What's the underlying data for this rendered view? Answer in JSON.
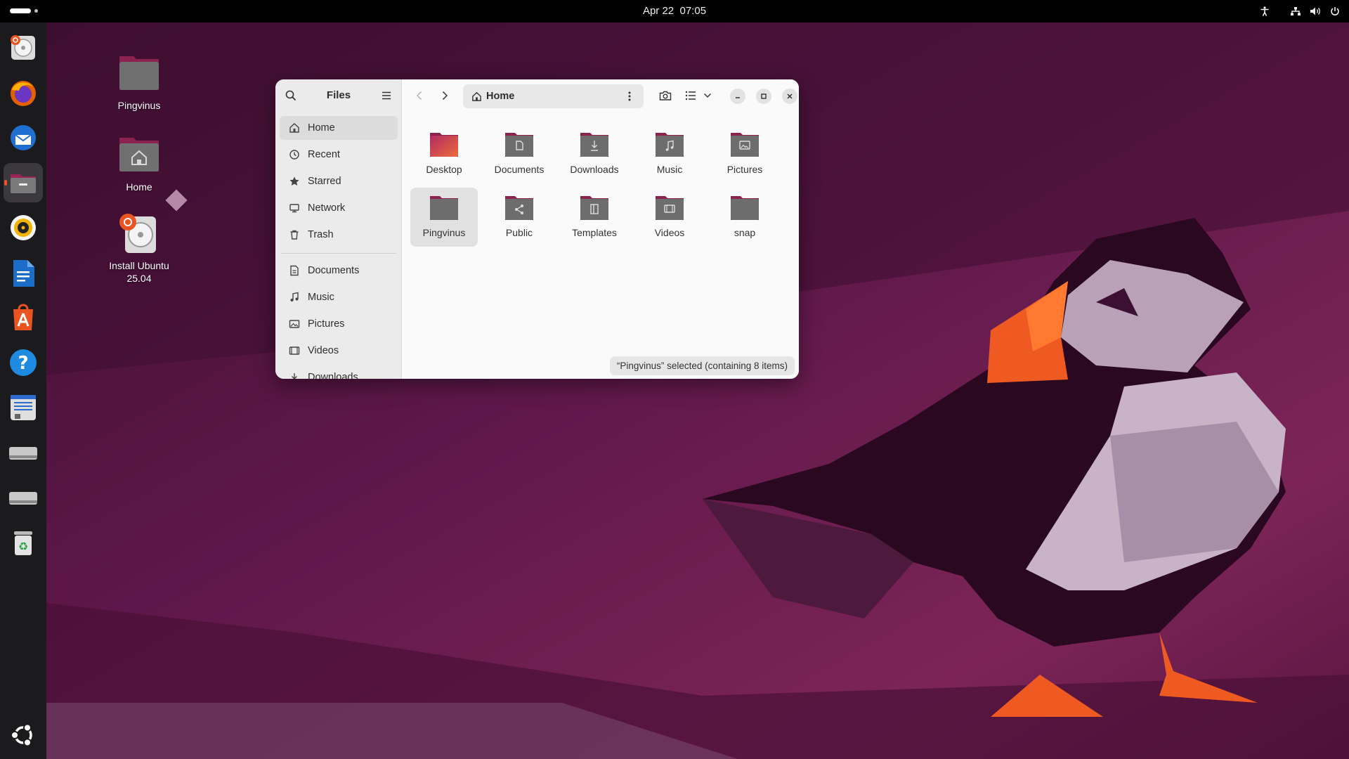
{
  "topbar": {
    "date": "Apr 22",
    "time": "07:05"
  },
  "dock": {
    "items": [
      {
        "name": "installer-dock-icon"
      },
      {
        "name": "firefox-dock-icon"
      },
      {
        "name": "thunderbird-dock-icon"
      },
      {
        "name": "files-dock-icon",
        "active": true
      },
      {
        "name": "rhythmbox-dock-icon"
      },
      {
        "name": "writer-dock-icon"
      },
      {
        "name": "app-center-dock-icon"
      },
      {
        "name": "help-dock-icon"
      },
      {
        "name": "text-editor-dock-icon"
      },
      {
        "name": "drive-dock-icon"
      },
      {
        "name": "drive-dock-icon"
      },
      {
        "name": "trash-dock-icon"
      }
    ],
    "show_apps_icon": "ubuntu-logo-icon"
  },
  "desktop": {
    "icons": [
      {
        "label": "Pingvinus"
      },
      {
        "label": "Home"
      },
      {
        "label_line1": "Install Ubuntu",
        "label_line2": "25.04"
      }
    ]
  },
  "files_window": {
    "title": "Files",
    "sidebar": {
      "items": [
        {
          "label": "Home",
          "icon": "home-icon",
          "selected": true
        },
        {
          "label": "Recent",
          "icon": "clock-icon"
        },
        {
          "label": "Starred",
          "icon": "star-icon"
        },
        {
          "label": "Network",
          "icon": "network-icon"
        },
        {
          "label": "Trash",
          "icon": "trash-icon"
        },
        {
          "label": "Documents",
          "icon": "document-icon"
        },
        {
          "label": "Music",
          "icon": "music-icon"
        },
        {
          "label": "Pictures",
          "icon": "picture-icon"
        },
        {
          "label": "Videos",
          "icon": "video-icon"
        },
        {
          "label": "Downloads",
          "icon": "download-icon"
        }
      ]
    },
    "path": {
      "label": "Home"
    },
    "files": [
      {
        "label": "Desktop",
        "icon": "desktop-folder-icon"
      },
      {
        "label": "Documents",
        "icon": "documents-folder-icon"
      },
      {
        "label": "Downloads",
        "icon": "downloads-folder-icon"
      },
      {
        "label": "Music",
        "icon": "music-folder-icon"
      },
      {
        "label": "Pictures",
        "icon": "pictures-folder-icon"
      },
      {
        "label": "Pingvinus",
        "icon": "folder-icon",
        "selected": true
      },
      {
        "label": "Public",
        "icon": "public-folder-icon"
      },
      {
        "label": "Templates",
        "icon": "templates-folder-icon"
      },
      {
        "label": "Videos",
        "icon": "videos-folder-icon"
      },
      {
        "label": "snap",
        "icon": "folder-icon"
      }
    ],
    "status": "“Pingvinus” selected  (containing 8 items)"
  },
  "colors": {
    "accent": "#e95420",
    "folder_tab": "#8c2250",
    "folder_body": "#6d6d6d"
  }
}
